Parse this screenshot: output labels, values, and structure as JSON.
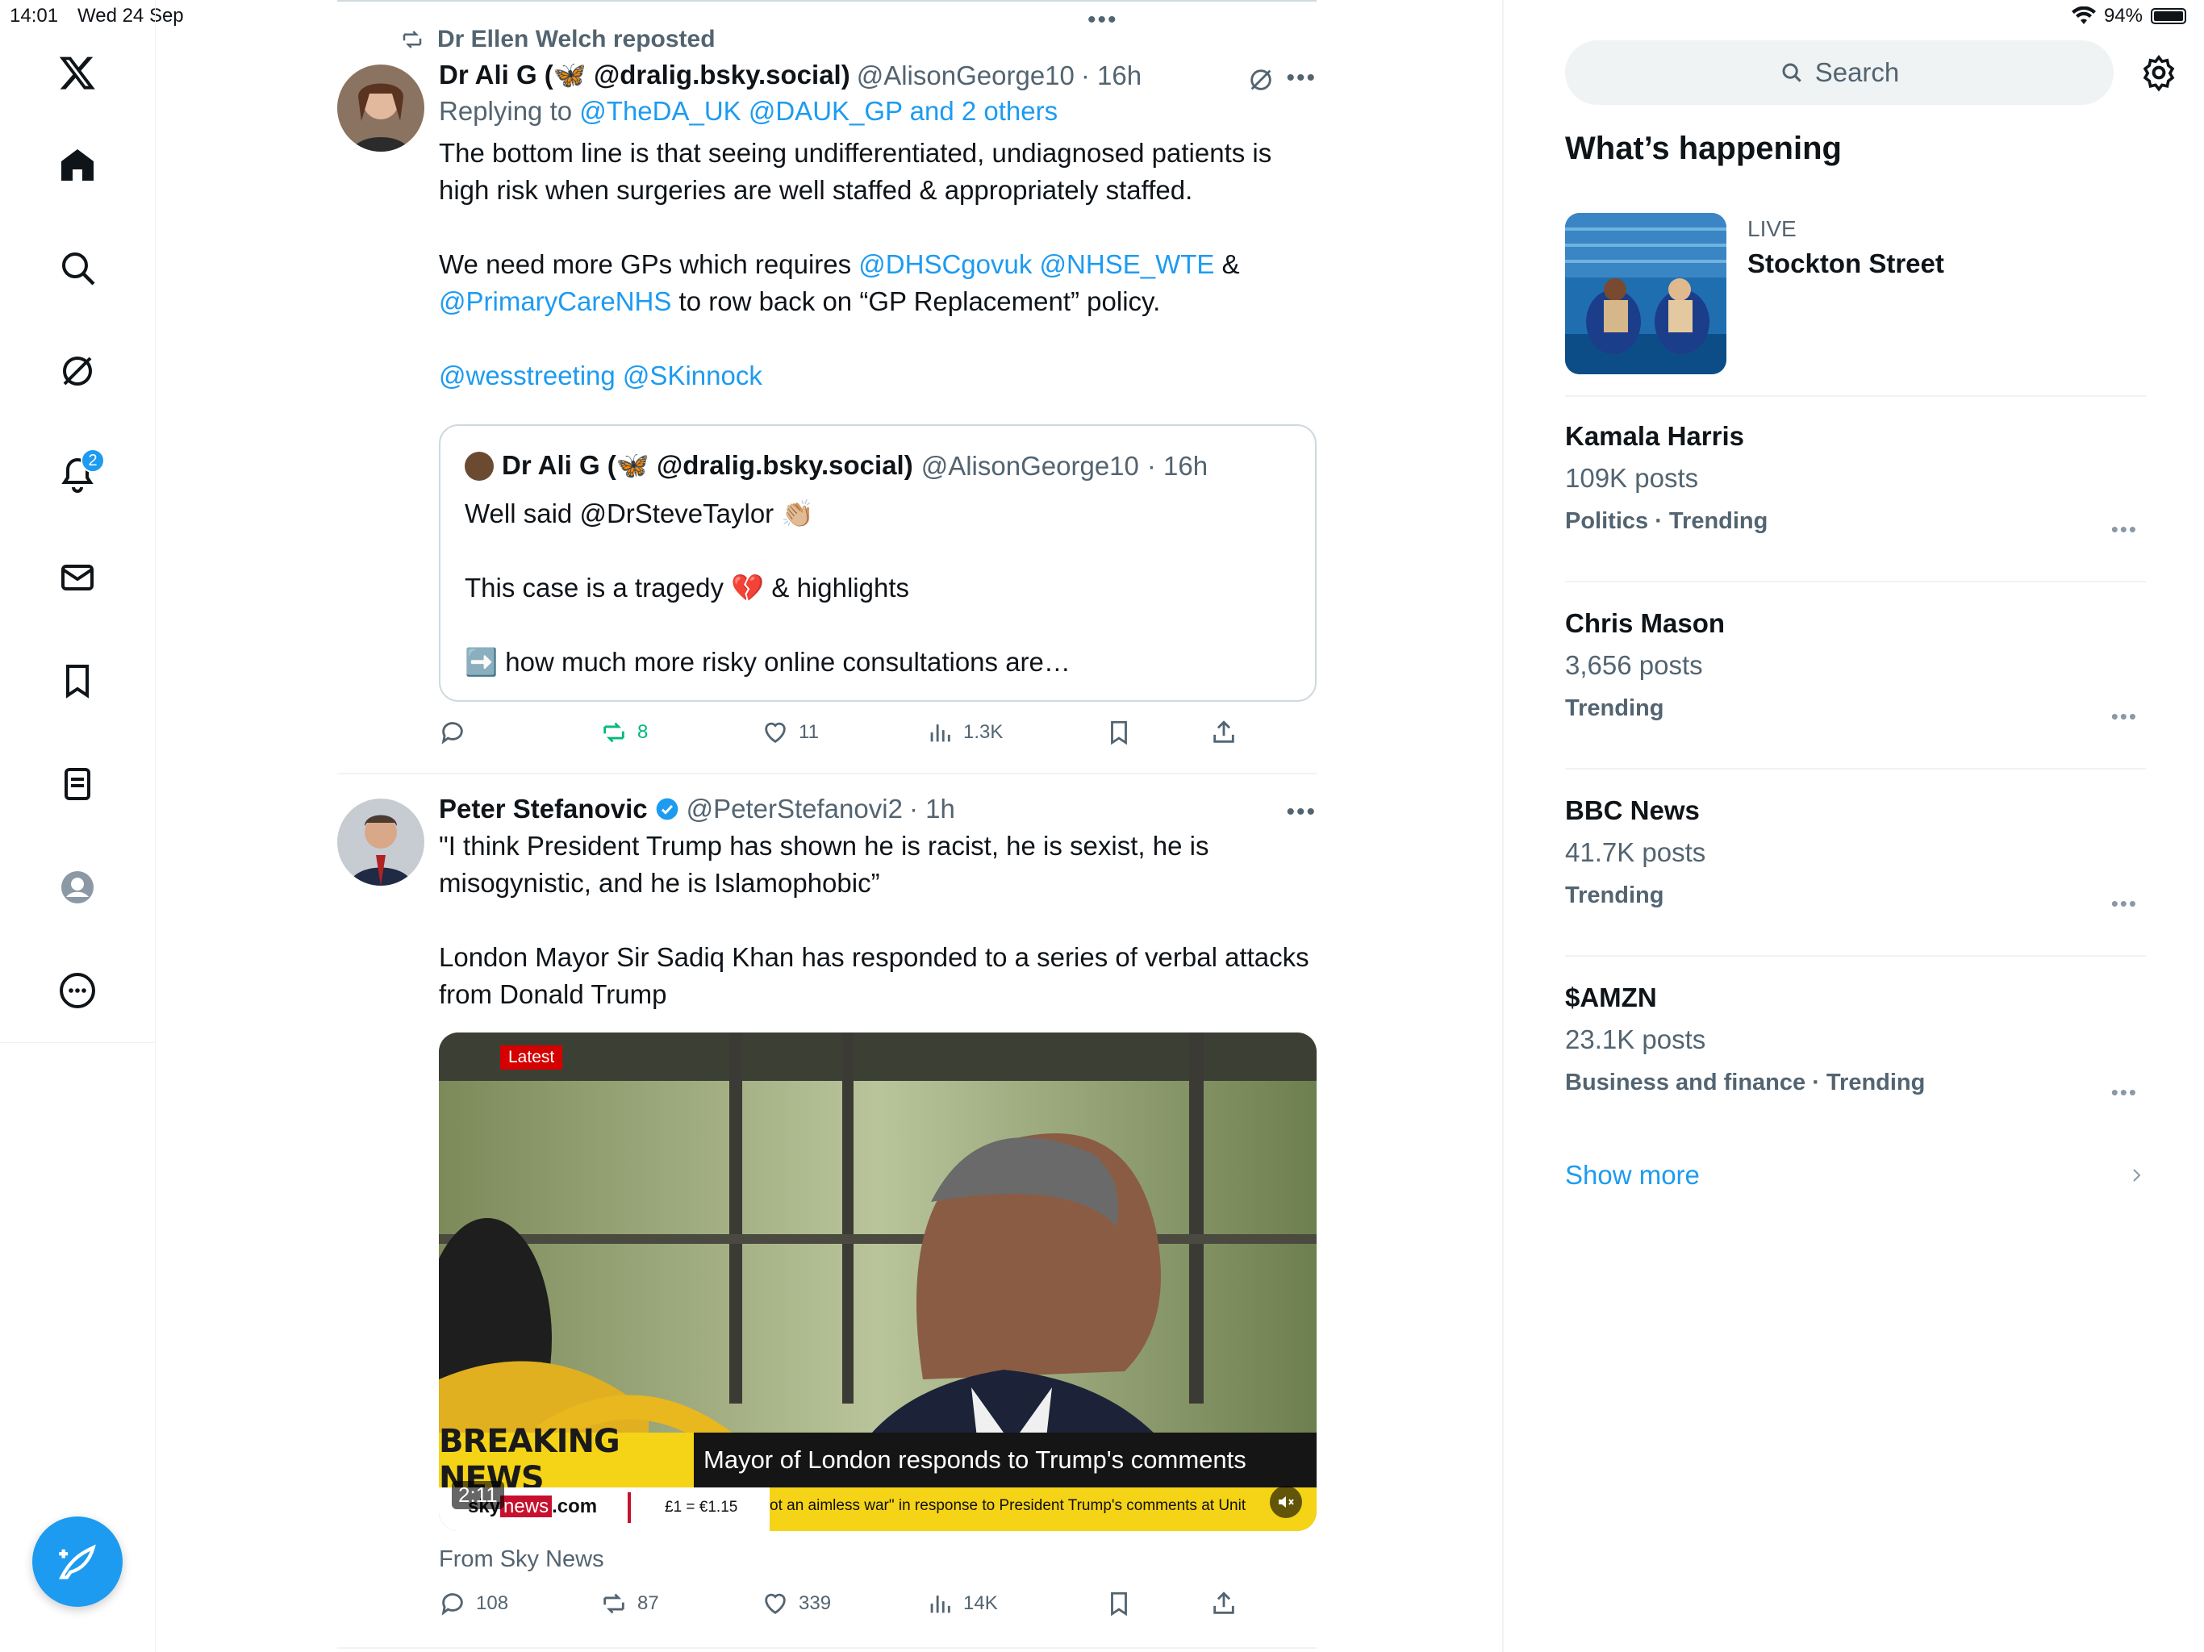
{
  "status_bar": {
    "time": "14:01",
    "date": "Wed 24 Sep",
    "battery": "94%"
  },
  "feed": {
    "tweet1": {
      "repost_label": "Dr Ellen Welch reposted",
      "name": "Dr Ali G (🦋 @dralig.bsky.social)",
      "handle": "@AlisonGeorge10",
      "time": "· 16h",
      "reply_prefix": "Replying to",
      "reply_to": "@TheDA_UK @DAUK_GP and 2 others",
      "text_p1": "The bottom line is that seeing undifferentiated, undiagnosed patients is high risk when surgeries are well staffed & appropriately staffed.",
      "text_p2_a": "We need more GPs which requires",
      "text_p2_link1": "@DHSCgovuk @NHSE_WTE",
      "text_p2_b": "&",
      "text_p2_link2": "@PrimaryCareNHS",
      "text_p2_c": "to row back on “GP Replacement” policy.",
      "text_p3": "@wesstreeting @SKinnock",
      "quote": {
        "name": "Dr Ali G (🦋 @dralig.bsky.social)",
        "handle": "@AlisonGeorge10",
        "time": "· 16h",
        "line1": "Well said @DrSteveTaylor 👏🏼",
        "line2": "This case is a tragedy 💔 & highlights",
        "line3": "➡️ how much more risky online consultations are…"
      },
      "actions": {
        "replies": "",
        "reposts": "8",
        "likes": "11",
        "views": "1.3K"
      }
    },
    "tweet2": {
      "name": "Peter Stefanovic",
      "handle": "@PeterStefanovi2",
      "time": "· 1h",
      "text_p1": "\"I think President Trump has shown he is racist, he is sexist, he is misogynistic, and he is Islamophobic”",
      "text_p2": "London Mayor Sir Sadiq Khan has responded to a series of verbal attacks from Donald Trump",
      "video": {
        "latest_tag": "Latest",
        "breaking": "BREAKING NEWS",
        "headline": "Mayor of London responds to Trump's comments",
        "duration": "2:11",
        "sky": "sky",
        "news": "news",
        "dotcom": ".com",
        "fx": "£1 = €1.15",
        "ticker": "ot an aimless war\" in response to President Trump's comments at Unit"
      },
      "source": "From Sky News",
      "actions": {
        "replies": "108",
        "reposts": "87",
        "likes": "339",
        "views": "14K"
      }
    }
  },
  "sidebar": {
    "search_placeholder": "Search",
    "section_title": "What’s happening",
    "live": {
      "label": "LIVE",
      "title": "Stockton Street"
    },
    "trends": [
      {
        "name": "Kamala Harris",
        "posts": "109K posts",
        "category": "Politics · Trending"
      },
      {
        "name": "Chris Mason",
        "posts": "3,656 posts",
        "category": "Trending"
      },
      {
        "name": "BBC News",
        "posts": "41.7K posts",
        "category": "Trending"
      },
      {
        "name": "$AMZN",
        "posts": "23.1K posts",
        "category": "Business and finance · Trending"
      }
    ],
    "show_more": "Show more"
  },
  "nav": {
    "notification_count": "2"
  },
  "colors": {
    "accent": "#1d9bf0",
    "repost_green": "#00ba7c",
    "breaking_yellow": "#f5d316",
    "latest_red": "#d50000"
  }
}
